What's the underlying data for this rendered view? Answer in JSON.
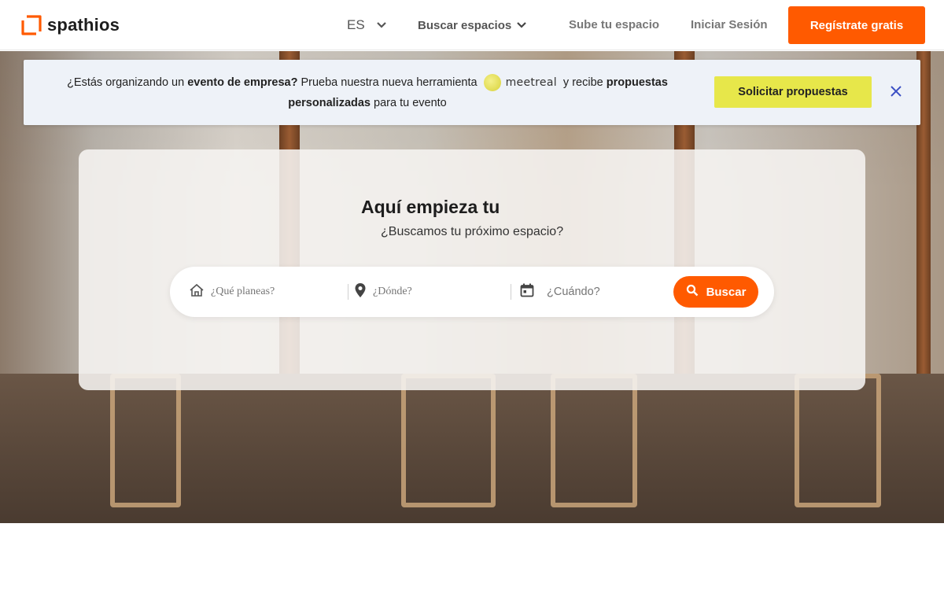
{
  "header": {
    "logo_text": "spathios",
    "language": "ES",
    "buscar_espacios": "Buscar espacios",
    "sube_espacio": "Sube tu espacio",
    "iniciar_sesion": "Iniciar Sesión",
    "registrate": "Regístrate gratis"
  },
  "banner": {
    "text_1": "¿Estás organizando un ",
    "text_bold_1": "evento de empresa?",
    "text_2": " Prueba nuestra nueva herramienta ",
    "brand": "meetreal",
    "text_3": " y recibe ",
    "text_bold_2": "propuestas personalizadas",
    "text_4": " para tu evento",
    "button": "Solicitar propuestas"
  },
  "hero": {
    "title": "Aquí empieza tu",
    "subtitle": "¿Buscamos tu próximo espacio?"
  },
  "search": {
    "what_placeholder": "¿Qué planeas?",
    "where_placeholder": "¿Dónde?",
    "when_placeholder": "¿Cuándo?",
    "button": "Buscar"
  },
  "colors": {
    "brand_orange": "#ff5a00",
    "banner_bg": "#eef2f8",
    "cta_yellow": "#e7e74a",
    "close_icon": "#3b4fc4"
  }
}
